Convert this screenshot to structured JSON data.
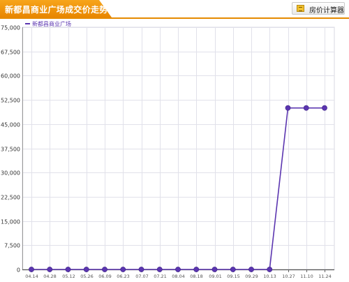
{
  "header": {
    "title": "新都昌商业广场成交价走势",
    "calc_button_label": "房价计算器",
    "calc_icon": "calculator-icon"
  },
  "colors": {
    "accent": "#f39c12",
    "series": "#5b35b0",
    "grid": "#e1e1ea",
    "axis": "#333333"
  },
  "chart_data": {
    "type": "line",
    "title": "新都昌商业广场成交价走势",
    "xlabel": "",
    "ylabel": "",
    "categories": [
      "04.14",
      "04.28",
      "05.12",
      "05.26",
      "06.09",
      "06.23",
      "07.07",
      "07.21",
      "08.04",
      "08.18",
      "09.01",
      "09.15",
      "09.29",
      "10.13",
      "10.27",
      "11.10",
      "11.24"
    ],
    "series": [
      {
        "name": "新都昌商业广场",
        "values": [
          0,
          0,
          0,
          0,
          0,
          0,
          0,
          0,
          0,
          0,
          0,
          0,
          0,
          0,
          50000,
          50000,
          50000
        ]
      }
    ],
    "ylim": [
      0,
      75000
    ],
    "yticks": [
      0,
      7500,
      15000,
      22500,
      30000,
      37500,
      45000,
      52500,
      60000,
      67500,
      75000
    ],
    "ytick_labels": [
      "0",
      "7,500",
      "15,000",
      "22,500",
      "30,000",
      "37,500",
      "45,000",
      "52,500",
      "60,000",
      "67,500",
      "75,000"
    ],
    "grid": true,
    "legend_position": "top-left"
  }
}
